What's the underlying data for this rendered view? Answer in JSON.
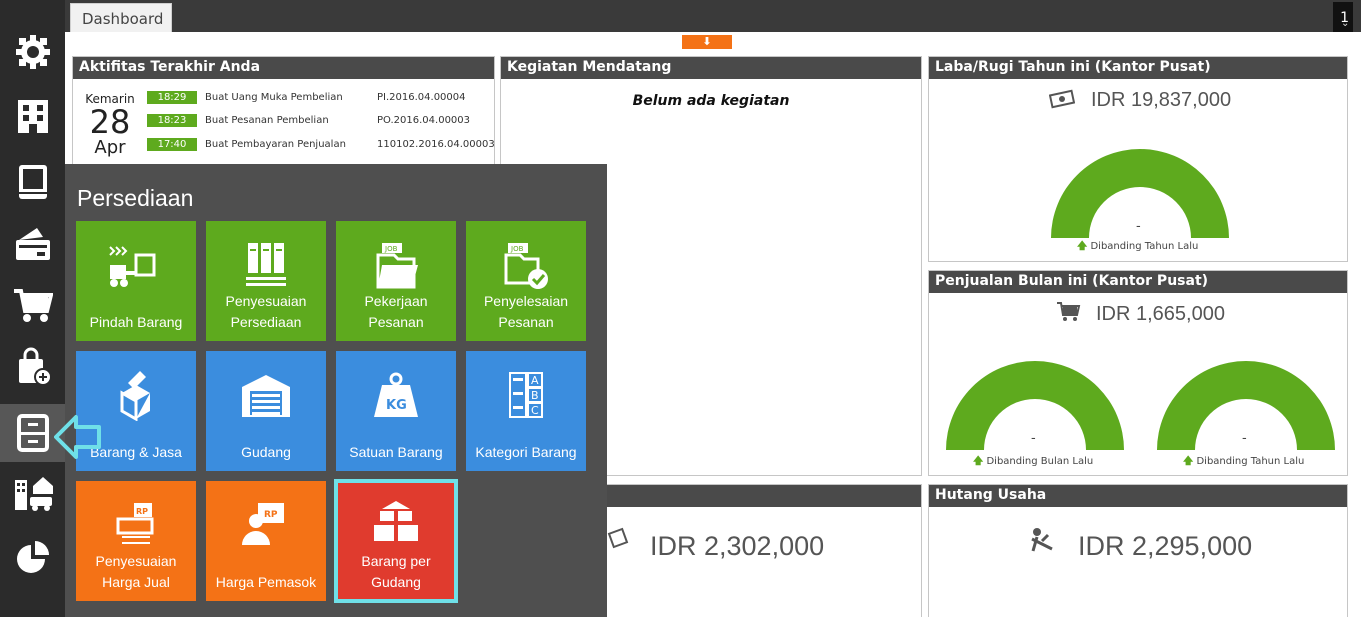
{
  "top_tab": "Dashboard",
  "page_number": "1",
  "icons": {
    "sidebar": [
      "gear-icon",
      "building-icon",
      "book-icon",
      "wallet-icon",
      "cart-icon",
      "shopping-bag-icon",
      "cabinet-icon",
      "building-car-icon",
      "pie-chart-icon"
    ],
    "arrow": "arrow-left-pointer-icon",
    "toggle": "arrow-down-icon"
  },
  "colors": {
    "green": "#5eaa1e",
    "blue": "#3b8dde",
    "orange": "#f47216",
    "red": "#e03b2e",
    "highlight": "#6fe0e8"
  },
  "activity": {
    "title": "Aktifitas Terakhir Anda",
    "day_label": "Kemarin",
    "day": "28",
    "month": "Apr",
    "items": [
      {
        "time": "18:29",
        "desc": "Buat Uang Muka Pembelian",
        "ref": "PI.2016.04.00004"
      },
      {
        "time": "18:23",
        "desc": "Buat Pesanan Pembelian",
        "ref": "PO.2016.04.00003"
      },
      {
        "time": "17:40",
        "desc": "Buat Pembayaran Penjualan",
        "ref": "110102.2016.04.00003"
      }
    ]
  },
  "events": {
    "title": "Kegiatan Mendatang",
    "empty": "Belum ada kegiatan"
  },
  "profit": {
    "title": "Laba/Rugi Tahun ini (Kantor Pusat)",
    "amount": "IDR 19,837,000",
    "gauge_value": "-",
    "caption": "Dibanding Tahun Lalu"
  },
  "sales": {
    "title": "Penjualan Bulan ini (Kantor Pusat)",
    "amount": "IDR 1,665,000",
    "gauge1_value": "-",
    "gauge1_caption": "Dibanding Bulan Lalu",
    "gauge2_value": "-",
    "gauge2_caption": "Dibanding Tahun Lalu"
  },
  "receivable": {
    "amount": "IDR 2,302,000"
  },
  "payable": {
    "title": "Hutang Usaha",
    "amount": "IDR 2,295,000"
  },
  "popup": {
    "title": "Persediaan",
    "tiles": [
      {
        "label": "Pindah Barang"
      },
      {
        "label": "Penyesuaian Persediaan"
      },
      {
        "label": "Pekerjaan Pesanan"
      },
      {
        "label": "Penyelesaian Pesanan"
      },
      {
        "label": "Barang & Jasa"
      },
      {
        "label": "Gudang"
      },
      {
        "label": "Satuan Barang"
      },
      {
        "label": "Kategori Barang"
      },
      {
        "label": "Penyesuaian Harga Jual"
      },
      {
        "label": "Harga Pemasok"
      },
      {
        "label": "Barang per Gudang"
      }
    ]
  }
}
